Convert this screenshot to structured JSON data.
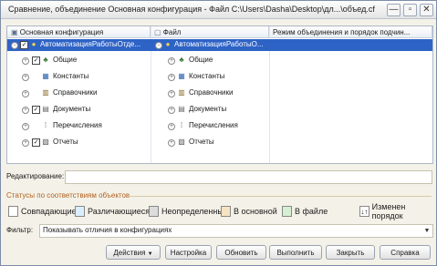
{
  "window": {
    "title": "Сравнение, объединение Основная конфигурация - Файл C:\\Users\\Dasha\\Desktop\\дл...\\объед.cf",
    "controls": [
      "—",
      "▫",
      "✕"
    ]
  },
  "tree": {
    "columns": [
      "Основная конфигурация",
      "Файл",
      "Режим объединения и порядок подчин..."
    ],
    "root_left": "АвтоматизацияРаботыОтде...",
    "root_right": "АвтоматизацияРаботыО...",
    "items": [
      {
        "left": "Общие",
        "right": "Общие",
        "checked": true
      },
      {
        "left": "Константы",
        "right": "Константы",
        "checked": false
      },
      {
        "left": "Справочники",
        "right": "Справочники",
        "checked": false
      },
      {
        "left": "Документы",
        "right": "Документы",
        "checked": true
      },
      {
        "left": "Перечисления",
        "right": "Перечисления",
        "checked": false
      },
      {
        "left": "Отчеты",
        "right": "Отчеты",
        "checked": true
      }
    ]
  },
  "edit": {
    "label": "Редактирование:",
    "value": ""
  },
  "status": {
    "title": "Статусы по соответствиям объектов",
    "legend": [
      {
        "label": "Совпадающие",
        "color": "#ffffff"
      },
      {
        "label": "Различающиеся",
        "color": "#dbeefd"
      },
      {
        "label": "Неопределенные",
        "color": "#dcdcdc"
      },
      {
        "label": "В основной",
        "color": "#f6e3c2"
      },
      {
        "label": "В файле",
        "color": "#d6efd2"
      },
      {
        "label": "Изменен порядок",
        "color": "#ffffff"
      }
    ]
  },
  "filter": {
    "label": "Фильтр:",
    "value": "Показывать отличия в конфигурациях"
  },
  "buttons": {
    "actions": "Действия",
    "settings": "Настройка",
    "refresh": "Обновить",
    "execute": "Выполнить",
    "close": "Закрыть",
    "help": "Справка"
  }
}
